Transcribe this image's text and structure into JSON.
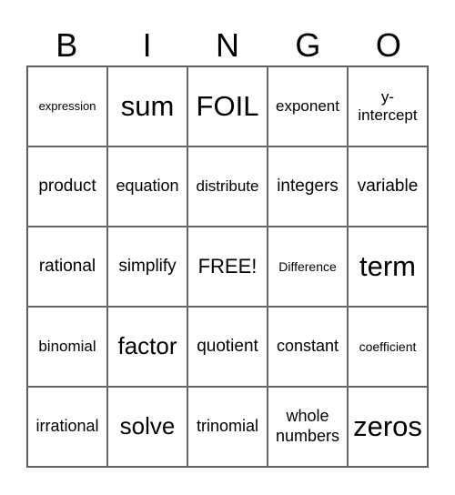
{
  "header": [
    "B",
    "I",
    "N",
    "G",
    "O"
  ],
  "cells": [
    [
      "expression",
      "sum",
      "FOIL",
      "exponent",
      "y-intercept"
    ],
    [
      "product",
      "equation",
      "distribute",
      "integers",
      "variable"
    ],
    [
      "rational",
      "simplify",
      "FREE!",
      "Difference",
      "term"
    ],
    [
      "binomial",
      "factor",
      "quotient",
      "constant",
      "coefficient"
    ],
    [
      "irrational",
      "solve",
      "trinomial",
      "whole numbers",
      "zeros"
    ]
  ]
}
